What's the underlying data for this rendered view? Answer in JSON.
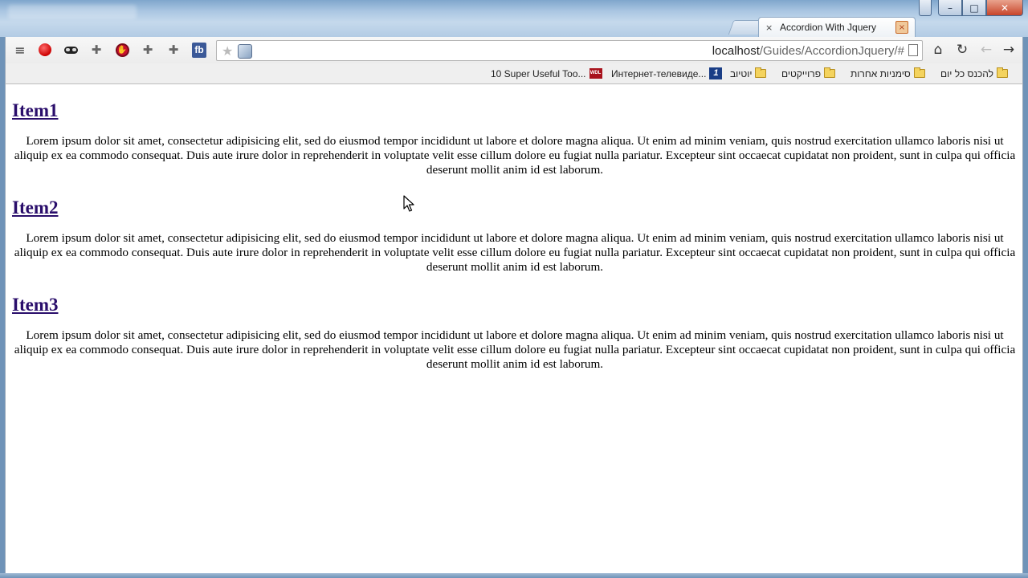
{
  "window": {
    "minimize": "–",
    "maximize": "□",
    "close": "✕"
  },
  "tabs": [
    {
      "title": "Accordion With Jquery",
      "close": "×",
      "favicon": "×"
    }
  ],
  "toolbar": {
    "menu_icon": "≡",
    "fb_label": "fb",
    "url_host": "localhost",
    "url_path": "/Guides/AccordionJquery/#",
    "star": "★"
  },
  "bookmarks": [
    {
      "label": "10 Super Useful Too...",
      "icon": "none"
    },
    {
      "label": "Интернет-телевиде...",
      "icon": "wdl-icon"
    },
    {
      "label": "יוטיוב",
      "icon": "channel1-icon"
    },
    {
      "label": "פרוייקטים",
      "icon": "folder-icon"
    },
    {
      "label": "סימניות אחרות",
      "icon": "folder-icon"
    },
    {
      "label": "להכנס כל יום",
      "icon": "folder-icon"
    }
  ],
  "bookmark_wdl_text": "WDL",
  "bookmark_channel_text": "1",
  "accordion": [
    {
      "heading": "Item1",
      "body": "Lorem ipsum dolor sit amet, consectetur adipisicing elit, sed do eiusmod tempor incididunt ut labore et dolore magna aliqua. Ut enim ad minim veniam, quis nostrud exercitation ullamco laboris nisi ut aliquip ex ea commodo consequat. Duis aute irure dolor in reprehenderit in voluptate velit esse cillum dolore eu fugiat nulla pariatur. Excepteur sint occaecat cupidatat non proident, sunt in culpa qui officia deserunt mollit anim id est laborum."
    },
    {
      "heading": "Item2",
      "body": "Lorem ipsum dolor sit amet, consectetur adipisicing elit, sed do eiusmod tempor incididunt ut labore et dolore magna aliqua. Ut enim ad minim veniam, quis nostrud exercitation ullamco laboris nisi ut aliquip ex ea commodo consequat. Duis aute irure dolor in reprehenderit in voluptate velit esse cillum dolore eu fugiat nulla pariatur. Excepteur sint occaecat cupidatat non proident, sunt in culpa qui officia deserunt mollit anim id est laborum."
    },
    {
      "heading": "Item3",
      "body": "Lorem ipsum dolor sit amet, consectetur adipisicing elit, sed do eiusmod tempor incididunt ut labore et dolore magna aliqua. Ut enim ad minim veniam, quis nostrud exercitation ullamco laboris nisi ut aliquip ex ea commodo consequat. Duis aute irure dolor in reprehenderit in voluptate velit esse cillum dolore eu fugiat nulla pariatur. Excepteur sint occaecat cupidatat non proident, sunt in culpa qui officia deserunt mollit anim id est laborum."
    }
  ],
  "colors": {
    "link_visited": "#2a0e6b",
    "fb_blue": "#3b5998",
    "frame_blue": "#6f93b8"
  }
}
